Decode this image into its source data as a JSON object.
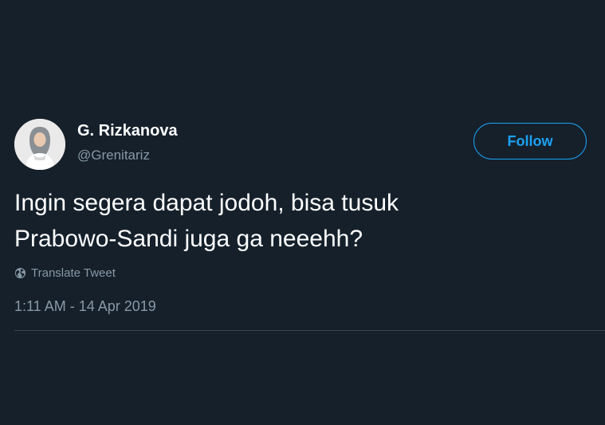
{
  "user": {
    "display_name": "G. Rizkanova",
    "handle": "@Grenitariz"
  },
  "follow_label": "Follow",
  "tweet": {
    "lines": [
      "Ingin segera dapat jodoh, bisa tusuk",
      "Prabowo-Sandi juga ga neeehh?"
    ],
    "translate_label": "Translate Tweet",
    "timestamp": "1:11 AM - 14 Apr 2019"
  },
  "icons": {
    "translate": "globe-icon",
    "avatar": "profile-photo"
  },
  "colors": {
    "background": "#15202b",
    "accent": "#1da1f2",
    "secondary_text": "#8899a6",
    "divider": "#38444d"
  }
}
